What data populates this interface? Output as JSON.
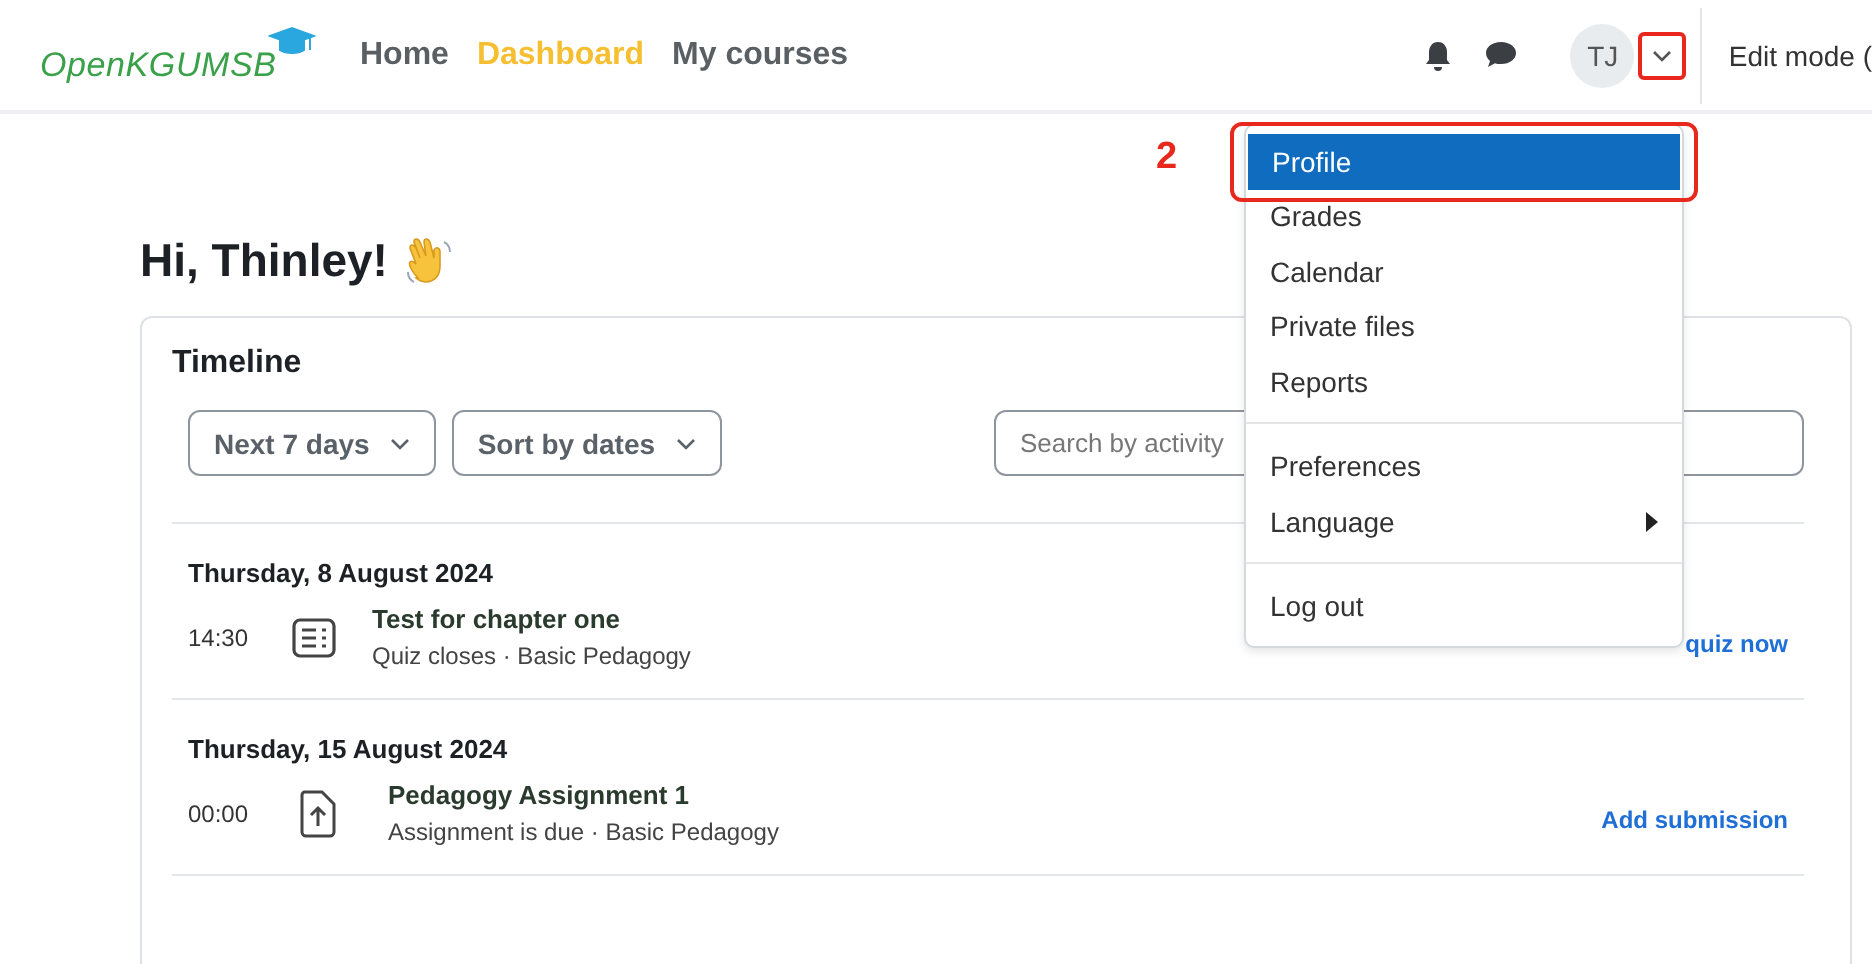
{
  "header": {
    "logo": "OpenKGUMSB",
    "nav": [
      {
        "label": "Home",
        "selected": false
      },
      {
        "label": "Dashboard",
        "selected": true
      },
      {
        "label": "My courses",
        "selected": false
      }
    ],
    "avatar": "TJ",
    "menu_toggle": {
      "highlighted": true
    },
    "edit_mode": "Edit mode ("
  },
  "user_menu": {
    "step_label": "2",
    "groups": [
      [
        {
          "label": "Profile",
          "selected": true,
          "highlighted": true,
          "submenu": false
        },
        {
          "label": "Grades",
          "selected": false,
          "highlighted": false,
          "submenu": false
        },
        {
          "label": "Calendar",
          "selected": false,
          "highlighted": false,
          "submenu": false
        },
        {
          "label": "Private files",
          "selected": false,
          "highlighted": false,
          "submenu": false
        },
        {
          "label": "Reports",
          "selected": false,
          "highlighted": false,
          "submenu": false
        }
      ],
      [
        {
          "label": "Preferences",
          "selected": false,
          "highlighted": false,
          "submenu": false
        },
        {
          "label": "Language",
          "selected": false,
          "highlighted": false,
          "submenu": true
        }
      ],
      [
        {
          "label": "Log out",
          "selected": false,
          "highlighted": false,
          "submenu": false
        }
      ]
    ]
  },
  "greeting": "Hi, Thinley!",
  "timeline": {
    "title": "Timeline",
    "filters": [
      "Next 7 days",
      "Sort by dates"
    ],
    "search": {
      "placeholder": "Search by activity"
    },
    "days": [
      {
        "date": "Thursday, 8 August 2024",
        "events": [
          {
            "time": "14:30",
            "kind": "quiz",
            "title": "Test for chapter one",
            "detail": "Quiz closes · Basic Pedagogy",
            "action": "quiz now"
          }
        ]
      },
      {
        "date": "Thursday, 15 August 2024",
        "events": [
          {
            "time": "00:00",
            "kind": "assignment",
            "title": "Pedagogy Assignment 1",
            "detail": "Assignment is due · Basic Pedagogy",
            "action": "Add submission"
          }
        ]
      }
    ]
  }
}
